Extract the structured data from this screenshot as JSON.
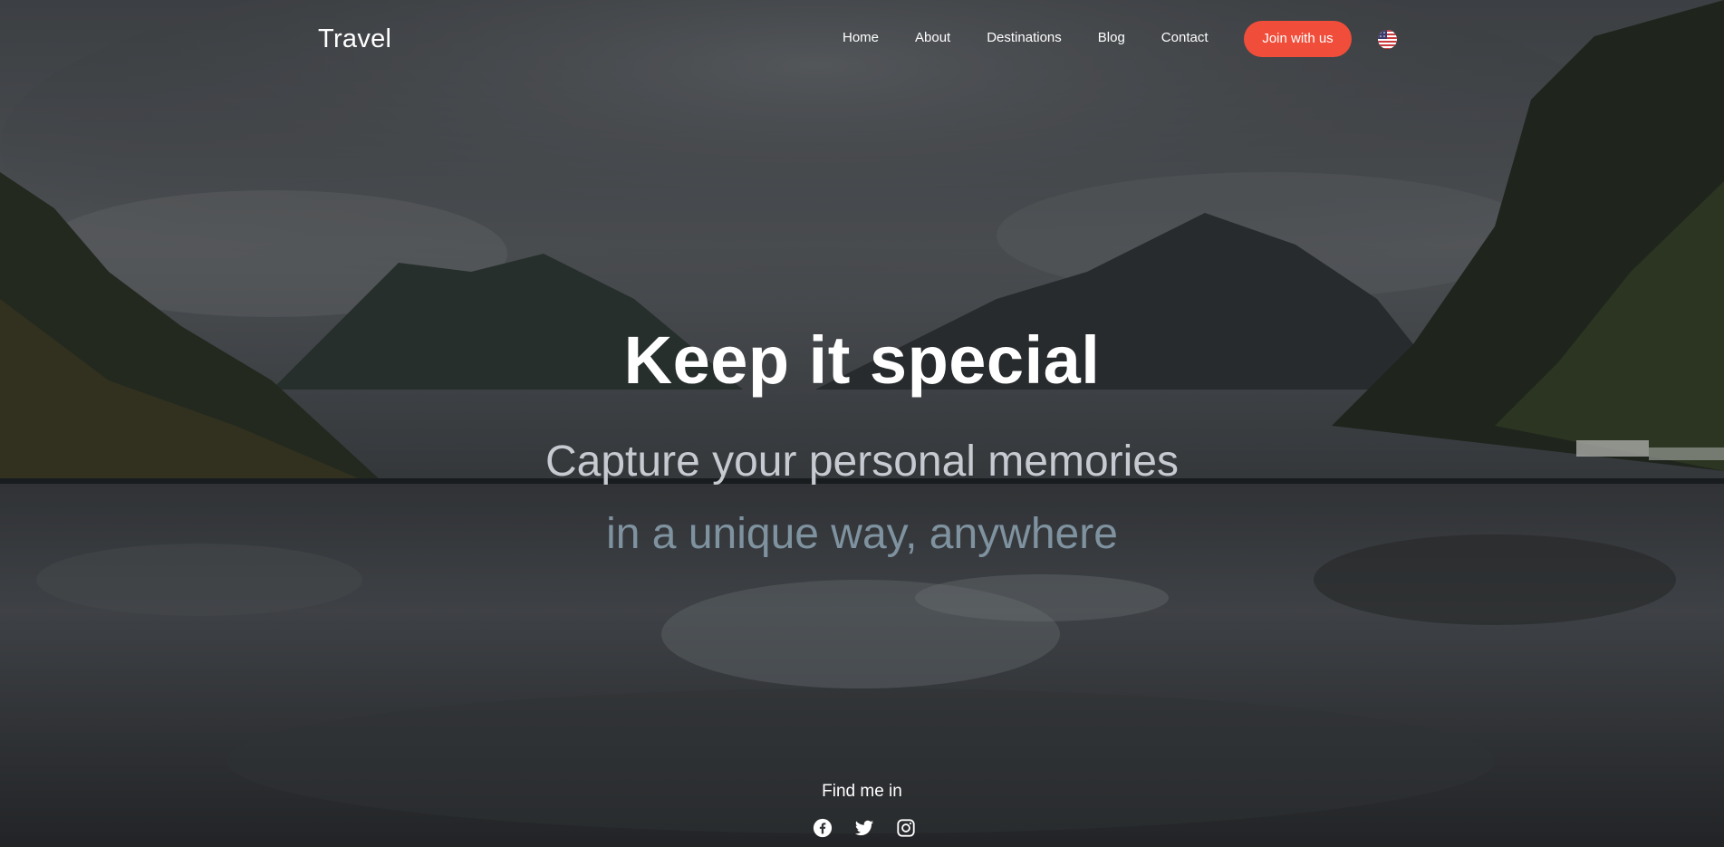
{
  "navbar": {
    "brand": "Travel",
    "links": [
      "Home",
      "About",
      "Destinations",
      "Blog",
      "Contact"
    ],
    "cta_label": "Join with us",
    "language_icon": "us-flag-icon"
  },
  "hero": {
    "headline": "Keep it special",
    "subline_1": "Capture your personal memories",
    "subline_2": "in a unique way, anywhere"
  },
  "social": {
    "title": "Find me in",
    "icons": [
      "facebook-icon",
      "twitter-icon",
      "instagram-icon"
    ]
  },
  "colors": {
    "accent": "#f04e3a",
    "text": "#ffffff"
  }
}
